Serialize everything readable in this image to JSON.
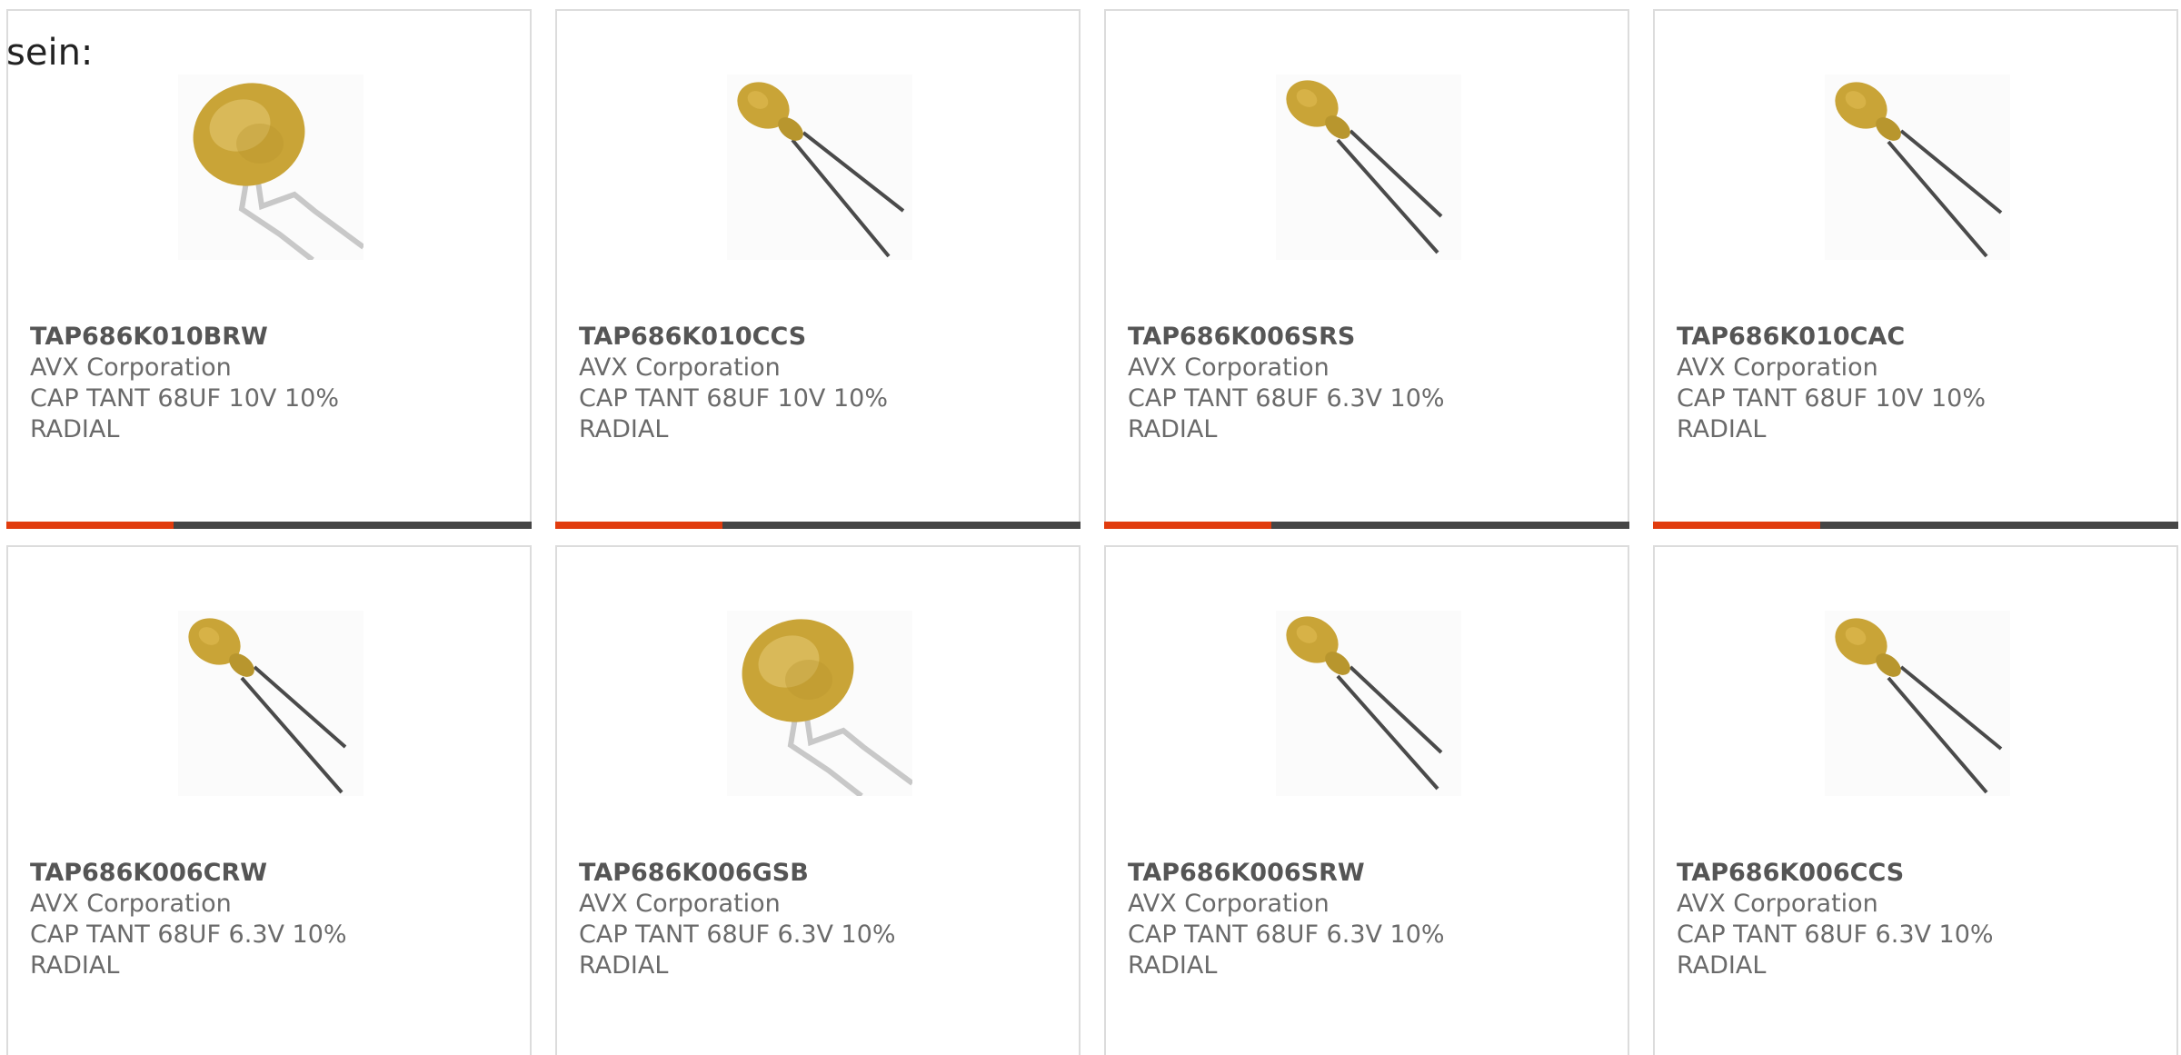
{
  "intro_text": "sein:",
  "colors": {
    "accent": "#e13c0e",
    "bar": "#454545",
    "border": "#dcdcdc",
    "capacitor_body": "#c9a437"
  },
  "products": [
    {
      "part": "TAP686K010BRW",
      "maker": "AVX Corporation",
      "desc1": "CAP TANT 68UF 10V 10%",
      "desc2": "RADIAL",
      "image": "dipped-disc-capacitor-icon"
    },
    {
      "part": "TAP686K010CCS",
      "maker": "AVX Corporation",
      "desc1": "CAP TANT 68UF 10V 10%",
      "desc2": "RADIAL",
      "image": "tantalum-bead-capacitor-icon"
    },
    {
      "part": "TAP686K006SRS",
      "maker": "AVX Corporation",
      "desc1": "CAP TANT 68UF 6.3V 10%",
      "desc2": "RADIAL",
      "image": "tantalum-bead-capacitor-icon"
    },
    {
      "part": "TAP686K010CAC",
      "maker": "AVX Corporation",
      "desc1": "CAP TANT 68UF 10V 10%",
      "desc2": "RADIAL",
      "image": "tantalum-bead-capacitor-icon"
    },
    {
      "part": "TAP686K006CRW",
      "maker": "AVX Corporation",
      "desc1": "CAP TANT 68UF 6.3V 10%",
      "desc2": "RADIAL",
      "image": "tantalum-bead-capacitor-icon"
    },
    {
      "part": "TAP686K006GSB",
      "maker": "AVX Corporation",
      "desc1": "CAP TANT 68UF 6.3V 10%",
      "desc2": "RADIAL",
      "image": "dipped-disc-capacitor-icon"
    },
    {
      "part": "TAP686K006SRW",
      "maker": "AVX Corporation",
      "desc1": "CAP TANT 68UF 6.3V 10%",
      "desc2": "RADIAL",
      "image": "tantalum-bead-capacitor-icon"
    },
    {
      "part": "TAP686K006CCS",
      "maker": "AVX Corporation",
      "desc1": "CAP TANT 68UF 6.3V 10%",
      "desc2": "RADIAL",
      "image": "tantalum-bead-capacitor-icon"
    }
  ]
}
